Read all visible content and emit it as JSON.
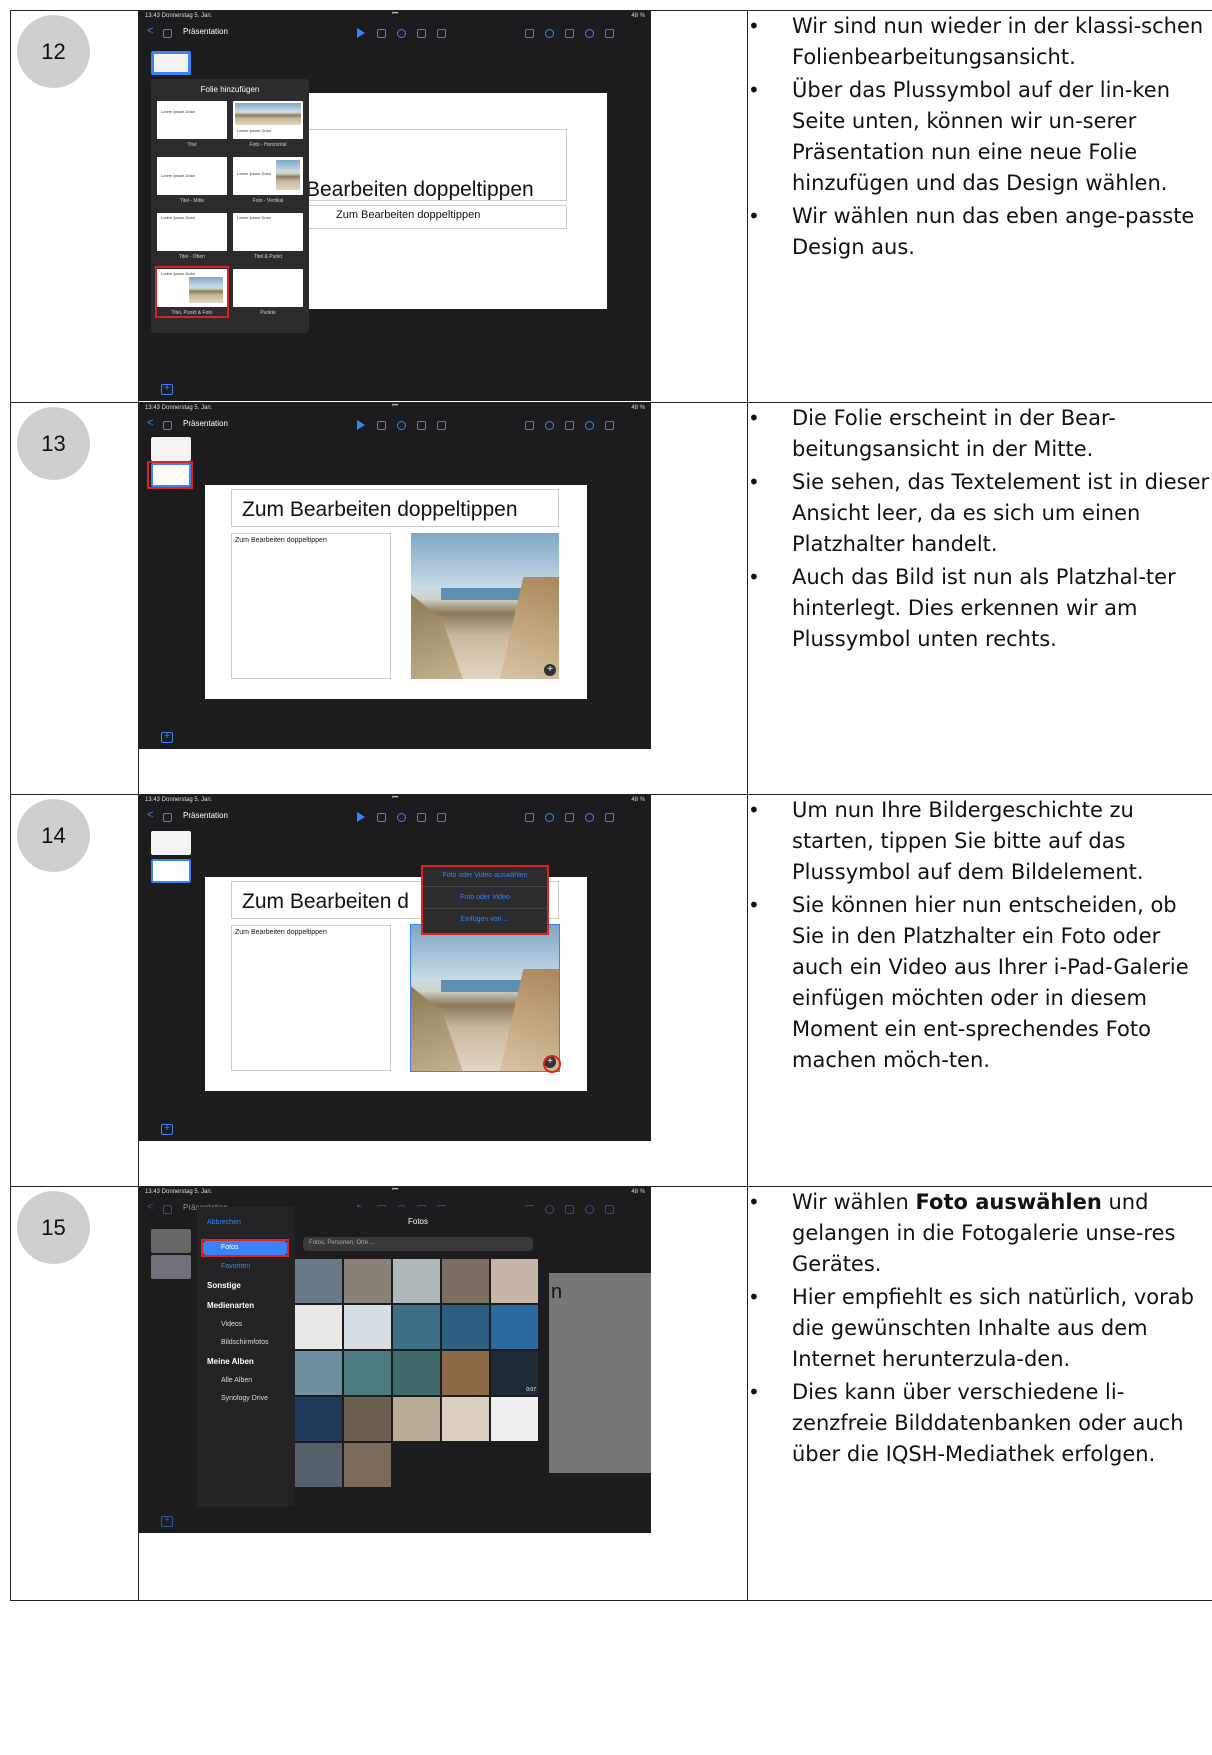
{
  "steps": [
    {
      "num": "12",
      "bullets": [
        "Wir sind nun wieder in der klassi-schen Folienbearbeitungsansicht.",
        "Über das Plussymbol auf der lin-ken Seite unten, können wir un-serer Präsentation nun eine neue Folie hinzufügen und das Design wählen.",
        "Wir wählen nun das eben ange-passte Design aus."
      ]
    },
    {
      "num": "13",
      "bullets": [
        "Die Folie erscheint in der Bear-beitungsansicht in der Mitte.",
        "Sie sehen, das Textelement ist in dieser Ansicht leer, da es sich um einen Platzhalter handelt.",
        "Auch das Bild ist nun als Platzhal-ter hinterlegt. Dies erkennen wir am Plussymbol unten rechts."
      ]
    },
    {
      "num": "14",
      "bullets": [
        "Um nun Ihre Bildergeschichte zu starten, tippen Sie bitte auf das Plussymbol auf dem Bildelement.",
        "Sie können hier nun entscheiden, ob Sie in den Platzhalter ein Foto oder auch ein Video aus Ihrer i-Pad-Galerie einfügen möchten oder in diesem Moment ein ent-sprechendes Foto machen möch-ten."
      ]
    },
    {
      "num": "15",
      "bullets_pre": "Wir wählen ",
      "bullets_bold": "Foto auswählen",
      "bullets_post": " und gelangen in die Fotogalerie unse-res Gerätes.",
      "bullets": [
        "Hier empfiehlt es sich natürlich, vorab die gewünschten Inhalte aus dem Internet herunterzula-den.",
        "Dies kann über verschiedene li-zenzfreie Bilddatenbanken oder auch über die IQSH-Mediathek erfolgen."
      ]
    }
  ],
  "ipad": {
    "status_left": "13:43  Donnerstag 5. Jan.",
    "status_center": "•••",
    "status_right": "48 %",
    "back": "<",
    "doc_title": "Präsentation",
    "slide_title": "Zum Bearbeiten doppeltippen",
    "slide_body": "Zum Bearbeiten doppeltippen",
    "slide_title_cut": "Bearbeiten doppeltippen",
    "slide_title_cut2": "Zum Bearbeiten d",
    "slide_title_cut3": "n"
  },
  "add_slide": {
    "title": "Folie hinzufügen",
    "card_text": "Lorem Ipsum Dolor",
    "layouts": [
      "Titel",
      "Foto - Horizontal",
      "Titel - Mitte",
      "Foto - Vertikal",
      "Titel - Oben",
      "Titel & Punkt",
      "Titel, Punkt & Foto",
      "Punkte"
    ]
  },
  "insert_menu": [
    "Foto oder Video auswählen",
    "Foto oder Video",
    "Einfügen von ..."
  ],
  "photos": {
    "cancel": "Abbrechen",
    "title": "Fotos",
    "search": "Fotos, Personen, Orte ...",
    "fotos": "Fotos",
    "favoriten": "Favoriten",
    "sonstige": "Sonstige",
    "medienarten": "Medienarten",
    "videos": "Videos",
    "bildschirmfotos": "Bildschirmfotos",
    "meine_alben": "Meine Alben",
    "alle_alben": "Alle Alben",
    "synology": "Synology Drive",
    "duration1": "0:07"
  },
  "colors": {
    "accent": "#3a82f7",
    "highlight": "#d22222",
    "badge": "#cfcfcf"
  }
}
